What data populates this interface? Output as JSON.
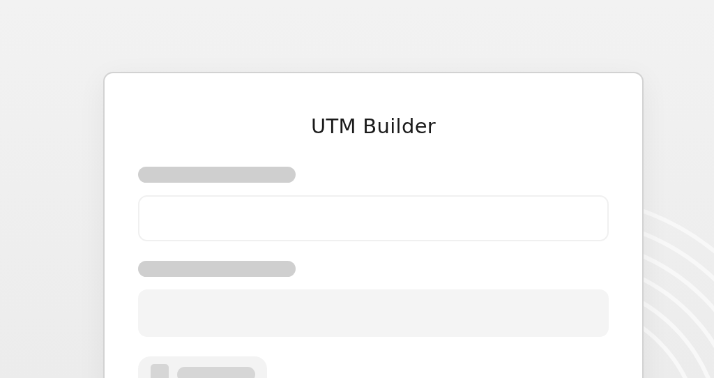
{
  "window": {
    "title": "UTM Builder"
  },
  "fields": [
    {
      "kind": "outlined"
    },
    {
      "kind": "filled"
    }
  ],
  "footer_control": {
    "kind": "toggle"
  }
}
